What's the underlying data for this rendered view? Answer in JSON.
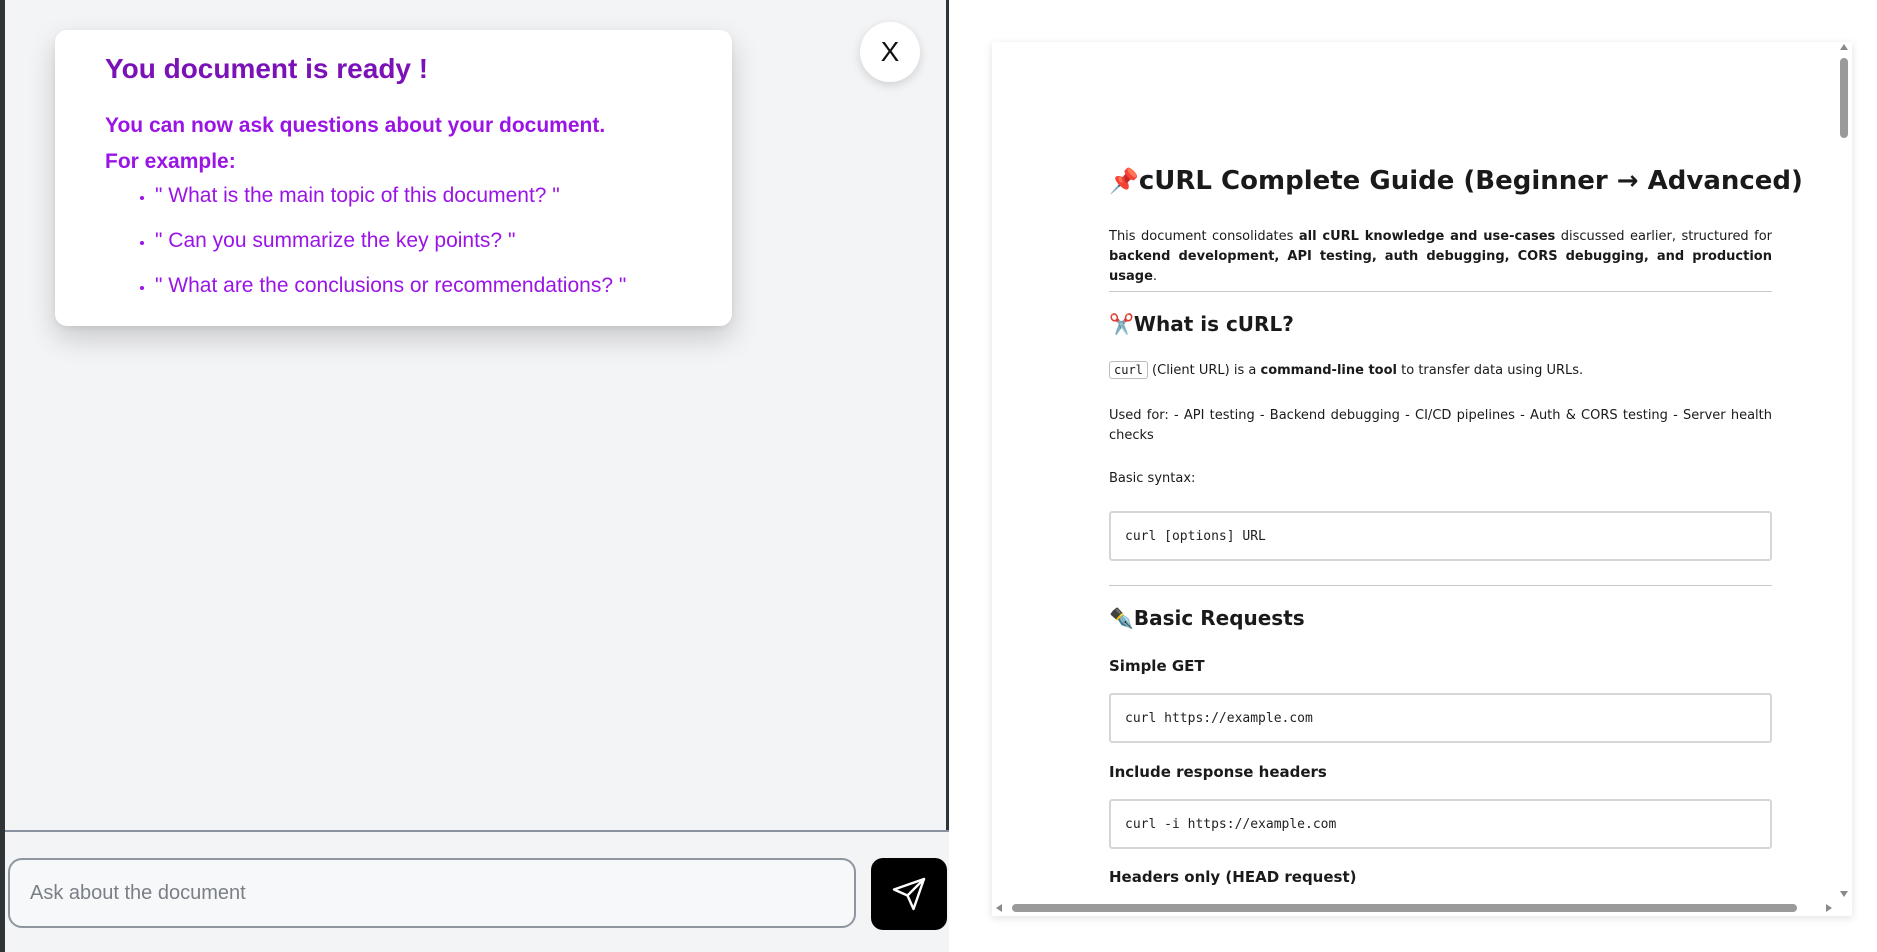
{
  "chat": {
    "welcome_title": "You document is ready !",
    "intro_line1": "You can now ask questions about your document.",
    "intro_line2": "For example:",
    "examples": [
      "\" What is the main topic of this document? \"",
      "\" Can you summarize the key points? \"",
      "\" What are the conclusions or recommendations? \""
    ],
    "close_label": "X",
    "input_placeholder": "Ask about the document",
    "send_icon": "send-icon"
  },
  "document": {
    "title_emoji": "📌",
    "title": "cURL Complete Guide (Beginner → Advanced)",
    "intro": {
      "pre": "This document consolidates ",
      "bold1": "all cURL knowledge and use-cases",
      "mid": " discussed earlier, structured for ",
      "bold2": "backend development, API testing, auth debugging, CORS debugging, and production usage",
      "post": "."
    },
    "section1": {
      "emoji": "✂️",
      "heading": "What is cURL?",
      "code_inline": "curl",
      "def_mid": " (Client URL) is a ",
      "def_bold": "command-line tool",
      "def_post": " to transfer data using URLs.",
      "uses": "Used for: - API testing - Backend debugging - CI/CD pipelines - Auth & CORS testing - Server health checks",
      "syntax_label": "Basic syntax:",
      "syntax_code": "curl [options] URL"
    },
    "section2": {
      "emoji": "✒️",
      "heading": "Basic Requests",
      "sub1": "Simple GET",
      "code1": "curl https://example.com",
      "sub2": "Include response headers",
      "code2": "curl -i https://example.com",
      "sub3": "Headers only (HEAD request)"
    }
  },
  "colors": {
    "title_purple": "#7a12b8",
    "text_purple": "#9a14e6",
    "panel_bg": "#f3f4f6"
  }
}
